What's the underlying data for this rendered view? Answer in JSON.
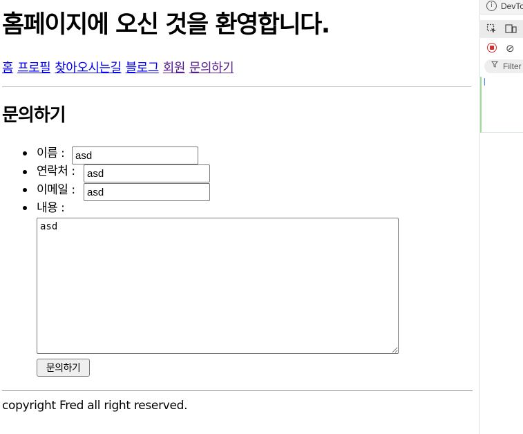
{
  "site": {
    "title": "홈페이지에 오신 것을 환영합니다."
  },
  "nav": {
    "items": [
      {
        "label": "홈"
      },
      {
        "label": "프로필"
      },
      {
        "label": "찾아오시는길"
      },
      {
        "label": "블로그"
      },
      {
        "label": "회원"
      },
      {
        "label": "문의하기"
      }
    ]
  },
  "contact": {
    "heading": "문의하기",
    "name_label": "이름 :",
    "name_value": "asd",
    "phone_label": "연락처 :",
    "phone_value": "asd",
    "email_label": "이메일 :",
    "email_value": "asd",
    "content_label": "내용 :",
    "content_value": "asd",
    "submit_label": "문의하기"
  },
  "footer": {
    "text": "copyright Fred all right reserved."
  },
  "devtools": {
    "title": "DevTo",
    "filter_label": "Filter",
    "icons": [
      "info-icon",
      "inspect-element-icon",
      "device-toggle-icon",
      "record-stop-icon",
      "clear-console-icon",
      "filter-icon"
    ]
  }
}
